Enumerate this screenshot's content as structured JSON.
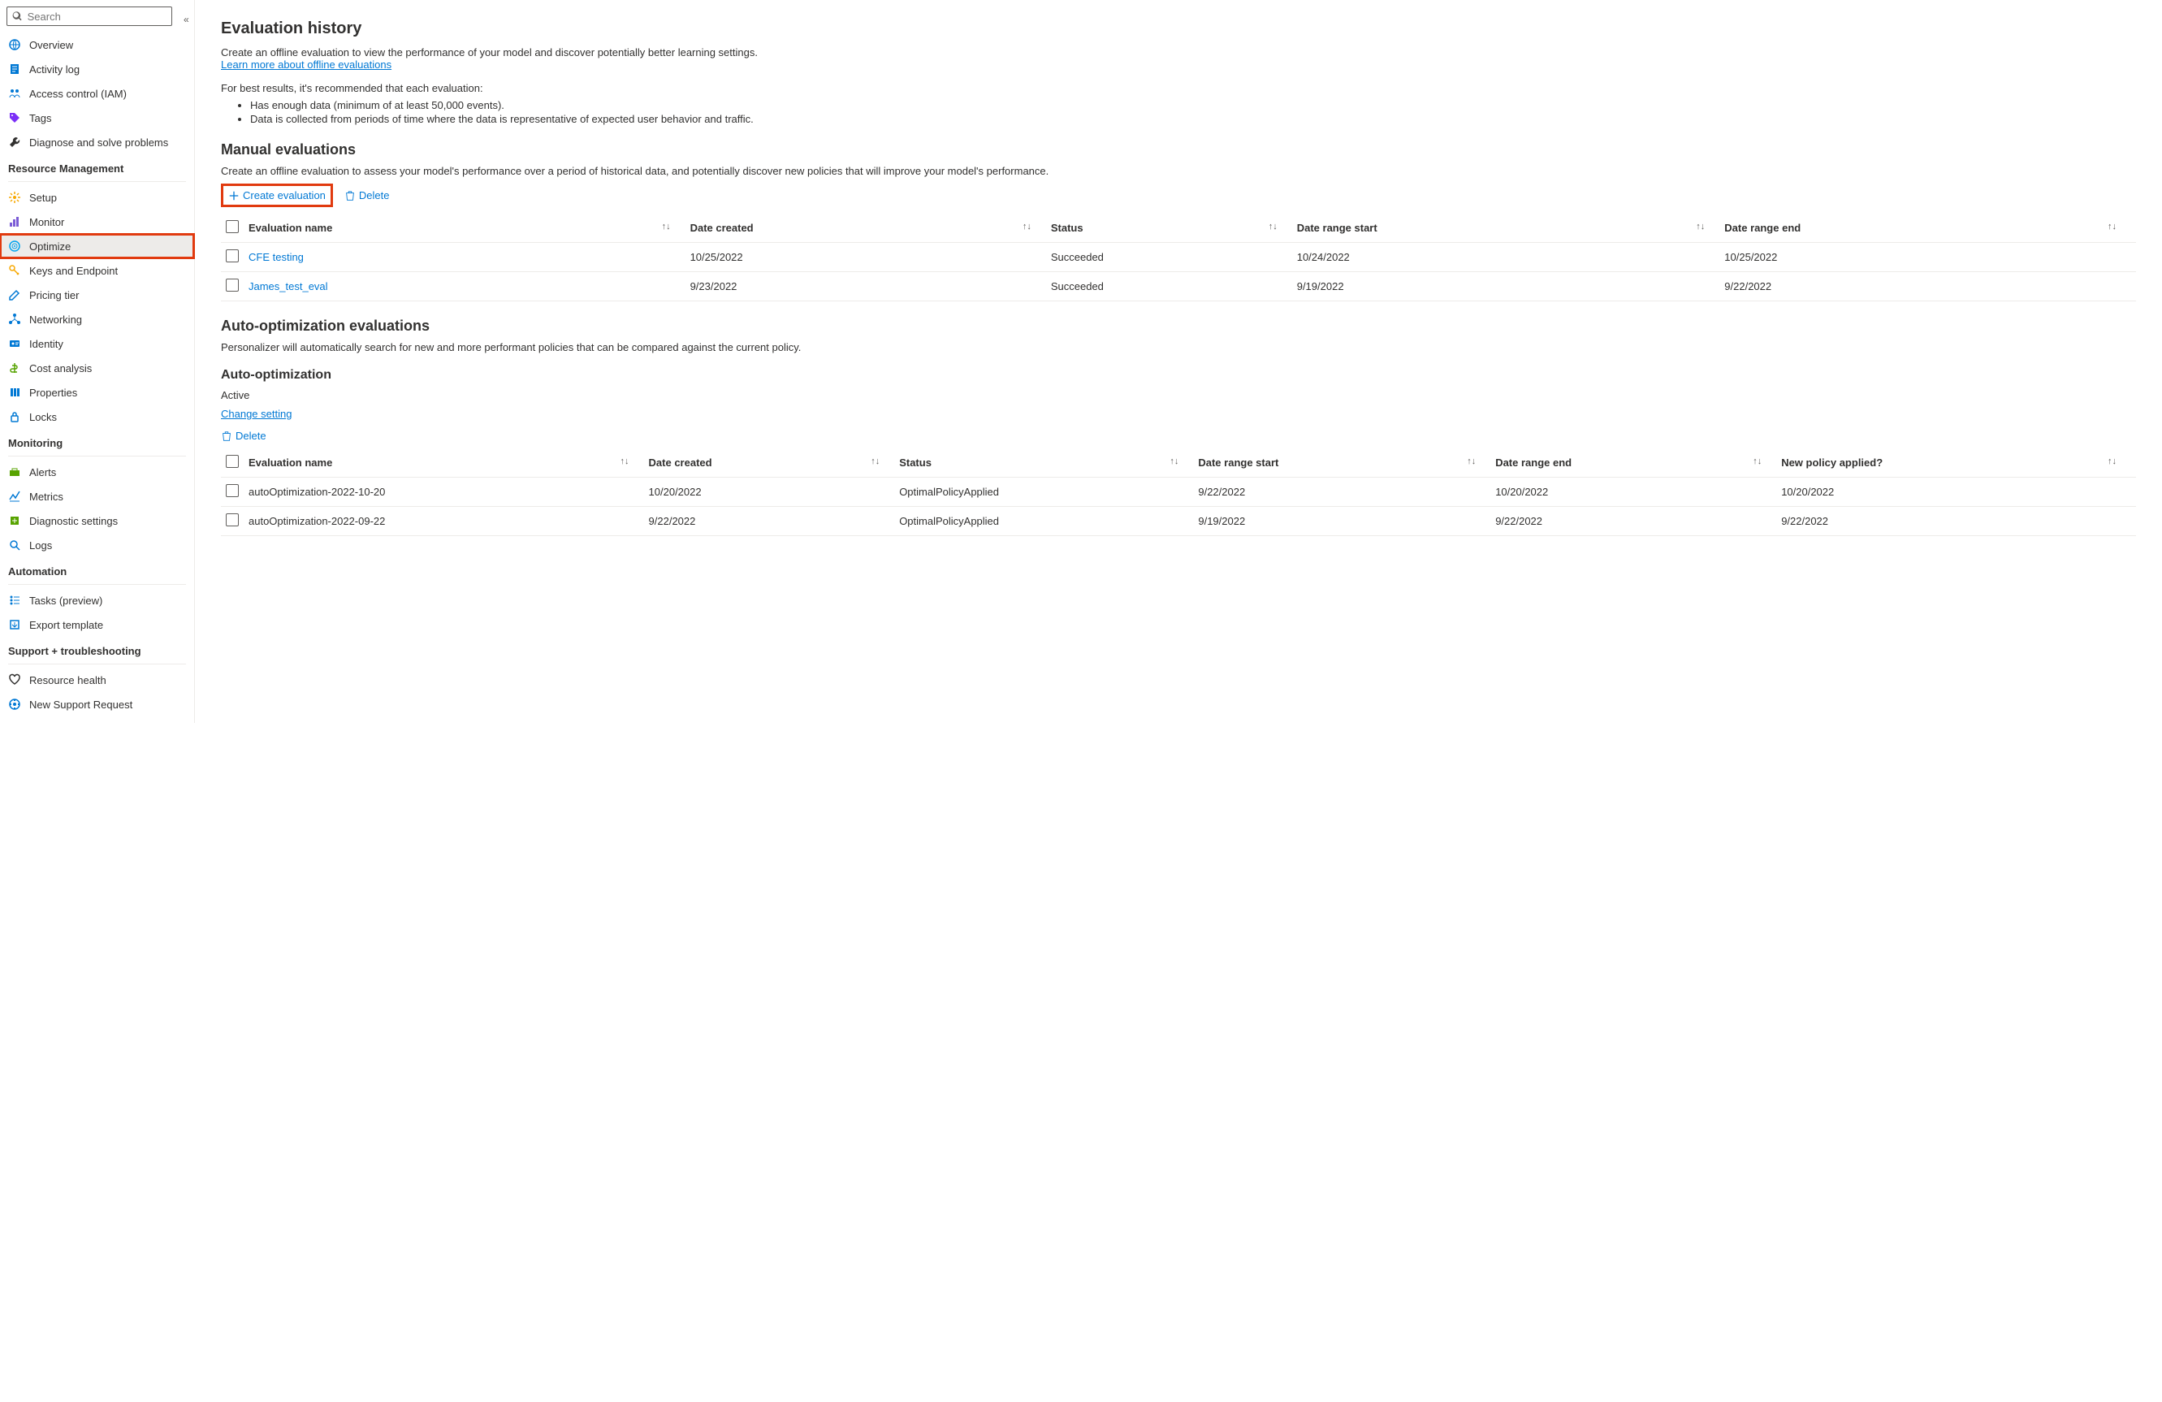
{
  "search": {
    "placeholder": "Search"
  },
  "sidebar": {
    "topItems": [
      {
        "label": "Overview",
        "icon": "globe",
        "color": "#0078d4"
      },
      {
        "label": "Activity log",
        "icon": "log",
        "color": "#0078d4"
      },
      {
        "label": "Access control (IAM)",
        "icon": "people",
        "color": "#0078d4"
      },
      {
        "label": "Tags",
        "icon": "tag",
        "color": "#7b2ff7"
      },
      {
        "label": "Diagnose and solve problems",
        "icon": "wrench",
        "color": "#323130"
      }
    ],
    "sections": [
      {
        "title": "Resource Management",
        "items": [
          {
            "label": "Setup",
            "icon": "gear",
            "color": "#f7a800"
          },
          {
            "label": "Monitor",
            "icon": "chart",
            "color": "#7b5cd6"
          },
          {
            "label": "Optimize",
            "icon": "target",
            "color": "#00a4ef",
            "selected": true,
            "highlighted": true
          },
          {
            "label": "Keys and Endpoint",
            "icon": "key",
            "color": "#f7a800"
          },
          {
            "label": "Pricing tier",
            "icon": "edit",
            "color": "#0078d4"
          },
          {
            "label": "Networking",
            "icon": "network",
            "color": "#0078d4"
          },
          {
            "label": "Identity",
            "icon": "identity",
            "color": "#0078d4"
          },
          {
            "label": "Cost analysis",
            "icon": "cost",
            "color": "#57a300"
          },
          {
            "label": "Properties",
            "icon": "props",
            "color": "#0078d4"
          },
          {
            "label": "Locks",
            "icon": "lock",
            "color": "#0078d4"
          }
        ]
      },
      {
        "title": "Monitoring",
        "items": [
          {
            "label": "Alerts",
            "icon": "alert",
            "color": "#57a300"
          },
          {
            "label": "Metrics",
            "icon": "metrics",
            "color": "#0078d4"
          },
          {
            "label": "Diagnostic settings",
            "icon": "diag",
            "color": "#57a300"
          },
          {
            "label": "Logs",
            "icon": "logs",
            "color": "#0078d4"
          }
        ]
      },
      {
        "title": "Automation",
        "items": [
          {
            "label": "Tasks (preview)",
            "icon": "tasks",
            "color": "#0078d4"
          },
          {
            "label": "Export template",
            "icon": "export",
            "color": "#0078d4"
          }
        ]
      },
      {
        "title": "Support + troubleshooting",
        "items": [
          {
            "label": "Resource health",
            "icon": "health",
            "color": "#323130"
          },
          {
            "label": "New Support Request",
            "icon": "support",
            "color": "#0078d4"
          }
        ]
      }
    ]
  },
  "main": {
    "title": "Evaluation history",
    "description": "Create an offline evaluation to view the performance of your model and discover potentially better learning settings.",
    "learnMore": "Learn more about offline evaluations",
    "recommendText": "For best results, it's recommended that each evaluation:",
    "bullets": [
      "Has enough data (minimum of at least 50,000 events).",
      "Data is collected from periods of time where the data is representative of expected user behavior and traffic."
    ],
    "manual": {
      "title": "Manual evaluations",
      "description": "Create an offline evaluation to assess your model's performance over a period of historical data, and potentially discover new policies that will improve your model's performance.",
      "createLabel": "Create evaluation",
      "deleteLabel": "Delete",
      "columns": [
        "Evaluation name",
        "Date created",
        "Status",
        "Date range start",
        "Date range end"
      ],
      "rows": [
        {
          "name": "CFE testing",
          "created": "10/25/2022",
          "status": "Succeeded",
          "start": "10/24/2022",
          "end": "10/25/2022"
        },
        {
          "name": "James_test_eval",
          "created": "9/23/2022",
          "status": "Succeeded",
          "start": "9/19/2022",
          "end": "9/22/2022"
        }
      ]
    },
    "autoEval": {
      "title": "Auto-optimization evaluations",
      "description": "Personalizer will automatically search for new and more performant policies that can be compared against the current policy."
    },
    "autoOpt": {
      "title": "Auto-optimization",
      "status": "Active",
      "changeSetting": "Change setting",
      "deleteLabel": "Delete",
      "columns": [
        "Evaluation name",
        "Date created",
        "Status",
        "Date range start",
        "Date range end",
        "New policy applied?"
      ],
      "rows": [
        {
          "name": "autoOptimization-2022-10-20",
          "created": "10/20/2022",
          "status": "OptimalPolicyApplied",
          "start": "9/22/2022",
          "end": "10/20/2022",
          "applied": "10/20/2022"
        },
        {
          "name": "autoOptimization-2022-09-22",
          "created": "9/22/2022",
          "status": "OptimalPolicyApplied",
          "start": "9/19/2022",
          "end": "9/22/2022",
          "applied": "9/22/2022"
        }
      ]
    }
  }
}
